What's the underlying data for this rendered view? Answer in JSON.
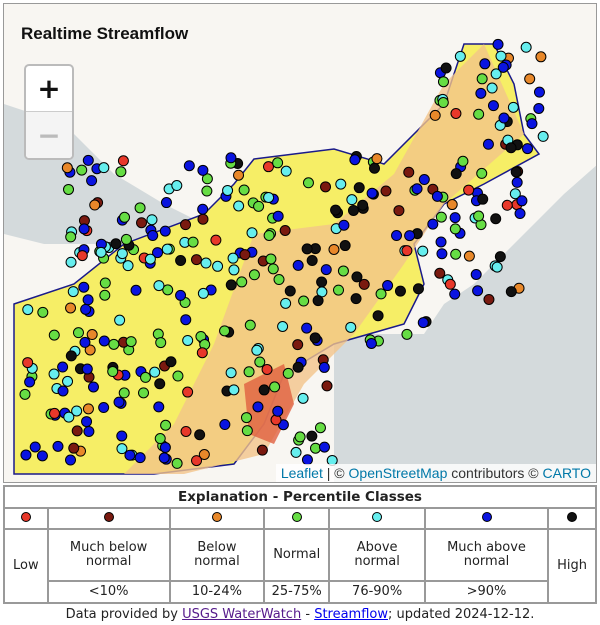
{
  "map": {
    "title": "Realtime Streamflow",
    "zoom_in": "+",
    "zoom_out": "−",
    "attribution": {
      "leaflet": "Leaflet",
      "sep": "|",
      "copy1": "©",
      "osm": "OpenStreetMap",
      "contrib": "contributors ©",
      "carto": "CARTO"
    }
  },
  "legend": {
    "title": "Explanation - Percentile Classes",
    "classes": [
      {
        "label": "Low",
        "range": "",
        "color": "#e8382a"
      },
      {
        "label": "Much below normal",
        "range": "<10%",
        "color": "#7a1a10"
      },
      {
        "label": "Below normal",
        "range": "10-24%",
        "color": "#e8882a"
      },
      {
        "label": "Normal",
        "range": "25-75%",
        "color": "#66dd44"
      },
      {
        "label": "Above normal",
        "range": "76-90%",
        "color": "#66eeee"
      },
      {
        "label": "Much above normal",
        "range": ">90%",
        "color": "#0a14e0"
      },
      {
        "label": "High",
        "range": "",
        "color": "#111111"
      }
    ],
    "footer": {
      "prefix": "Data provided by",
      "link1": "USGS WaterWatch",
      "dash": "-",
      "link2": "Streamflow",
      "suffix": "; updated 2024-12-12."
    }
  }
}
